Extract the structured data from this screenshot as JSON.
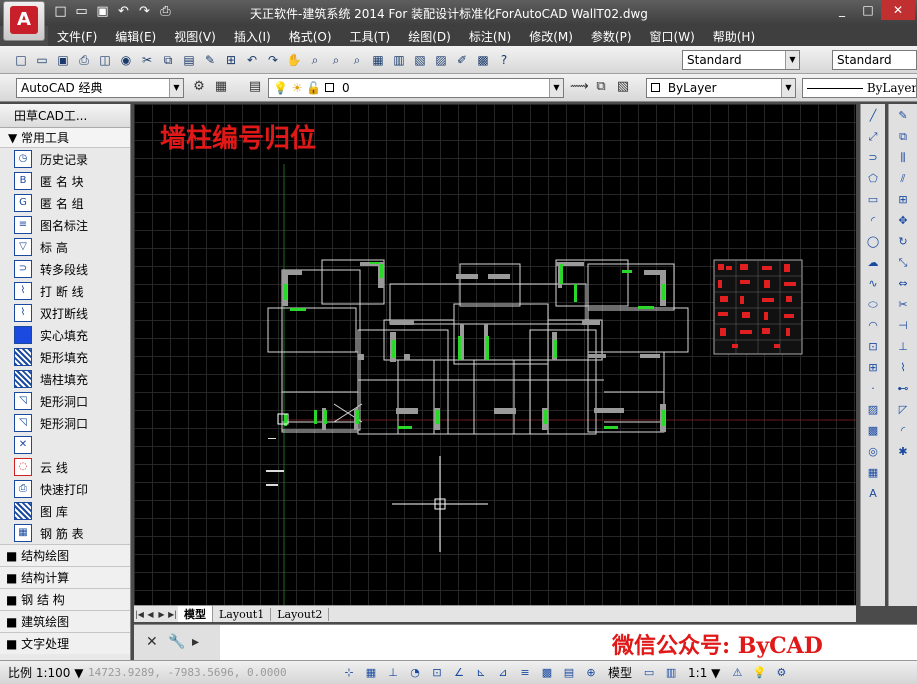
{
  "titlebar": {
    "title": "天正软件-建筑系统 2014  For 装配设计标准化ForAutoCAD    WallT02.dwg",
    "app_logo": "A"
  },
  "menu": [
    "文件(F)",
    "编辑(E)",
    "视图(V)",
    "插入(I)",
    "格式(O)",
    "工具(T)",
    "绘图(D)",
    "标注(N)",
    "修改(M)",
    "参数(P)",
    "窗口(W)",
    "帮助(H)"
  ],
  "toolbar": {
    "text_style": "Standard",
    "dim_style": "Standard",
    "workspace": "AutoCAD 经典",
    "layer": "0",
    "color": "ByLayer",
    "linetype": "ByLayer"
  },
  "left_panel": {
    "title": "田草CAD工...",
    "section_open": "▼ 常用工具",
    "items": [
      {
        "label": "历史记录",
        "icon": "clock-icon"
      },
      {
        "label": "匿 名 块",
        "icon": "block-icon"
      },
      {
        "label": "匿 名 组",
        "icon": "group-icon"
      },
      {
        "label": "图名标注",
        "icon": "title-label-icon"
      },
      {
        "label": "标    高",
        "icon": "elevation-icon"
      },
      {
        "label": "转多段线",
        "icon": "polyline-icon"
      },
      {
        "label": "打 断 线",
        "icon": "break-line-icon"
      },
      {
        "label": "双打断线",
        "icon": "double-break-icon"
      },
      {
        "label": "实心填充",
        "icon": "solid-fill-icon"
      },
      {
        "label": "矩形填充",
        "icon": "rect-fill-icon"
      },
      {
        "label": "墙柱填充",
        "icon": "wall-fill-icon"
      },
      {
        "label": "矩形洞口",
        "icon": "rect-opening-icon"
      },
      {
        "label": "矩形洞口",
        "icon": "rect-opening-icon"
      },
      {
        "label": "",
        "icon": "cross-box-icon"
      },
      {
        "label": "云    线",
        "icon": "cloud-icon"
      },
      {
        "label": "快速打印",
        "icon": "print-icon"
      },
      {
        "label": "图    库",
        "icon": "library-icon"
      },
      {
        "label": "钢 筋 表",
        "icon": "rebar-table-icon"
      }
    ],
    "collapsed_sections": [
      "■ 结构绘图",
      "■ 结构计算",
      "■ 钢 结 构",
      "■ 建筑绘图",
      "■ 文字处理"
    ]
  },
  "canvas": {
    "heading": "墙柱编号归位"
  },
  "layout_tabs": [
    "模型",
    "Layout1",
    "Layout2"
  ],
  "command_line": {
    "watermark": "微信公众号: ByCAD"
  },
  "statusbar": {
    "scale": "比例 1:100 ▼",
    "coords": "14723.9289, -7983.5696, 0.0000",
    "model_label": "模型",
    "annotation_scale": "1:1 ▼"
  }
}
